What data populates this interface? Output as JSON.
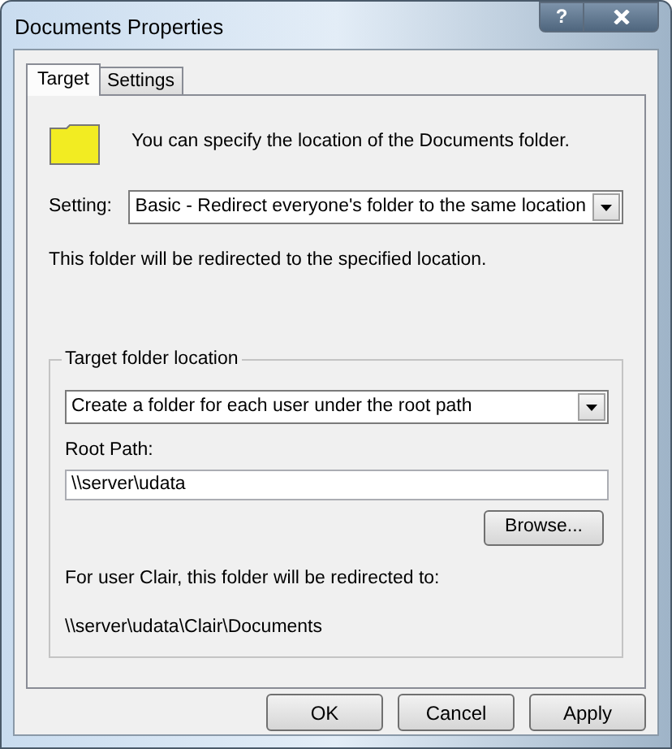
{
  "window": {
    "title": "Documents Properties",
    "help": "?"
  },
  "tabs": [
    {
      "label": "Target",
      "selected": true
    },
    {
      "label": "Settings",
      "selected": false
    }
  ],
  "intro": "You can specify the location of the Documents folder.",
  "setting": {
    "label": "Setting:",
    "value": "Basic - Redirect everyone's folder to the same location"
  },
  "note": "This folder will be redirected to the specified location.",
  "target_group": {
    "legend": "Target folder location",
    "option": "Create a folder for each user under the root path",
    "root_path_label": "Root Path:",
    "root_path": "\\\\server\\udata",
    "browse": "Browse...",
    "preview_label": "For user Clair, this folder will be redirected to:",
    "preview_path": "\\\\server\\udata\\Clair\\Documents"
  },
  "buttons": [
    "OK",
    "Cancel",
    "Apply"
  ]
}
